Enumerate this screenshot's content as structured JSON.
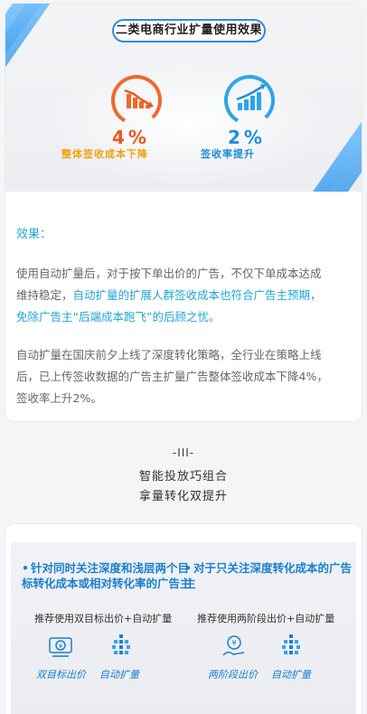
{
  "banner": {
    "title": "二类电商行业扩量使用效果",
    "metrics": [
      {
        "value": "4%",
        "label": "整体签收成本下降",
        "color": "#e9571d"
      },
      {
        "value": "2%",
        "label": "签收率提升",
        "color": "#1f8de0"
      }
    ]
  },
  "effect": {
    "title": "效果：",
    "para1_line1": "使用自动扩量后，对于按下单出价的广告，不仅下单成本达成",
    "para1_line2a": "维持稳定，",
    "para1_line2b": "自动扩量的扩展人群签收成本也符合广告主预期，",
    "para1_line3": "免除广告主“后端成本跑飞”的后顾之忧。",
    "para2_line1": "自动扩量在国庆前夕上线了深度转化策略，全行业在策略上线",
    "para2_line2": "后，已上传签收数据的广告主扩量广告整体签收成本下降4%，",
    "para2_line3": "签收率上升2%。"
  },
  "section": {
    "number": "-III-",
    "line1": "智能投放巧组合",
    "line2": "拿量转化双提升"
  },
  "cases": [
    {
      "bullet": "•",
      "title": "针对同时关注深度和浅层两个目标转化成本或相对转化率的广告主",
      "recommend": "推荐使用双目标出价+自动扩量",
      "tools": [
        {
          "icon": "yuan-dual-target-icon",
          "label": "双目标出价"
        },
        {
          "icon": "auto-expand-icon",
          "label": "自动扩量"
        }
      ]
    },
    {
      "bullet": "•",
      "title": "对于只关注深度转化成本的广告主",
      "recommend": "推荐使用两阶段出价+自动扩量",
      "tools": [
        {
          "icon": "yuan-two-stage-icon",
          "label": "两阶段出价"
        },
        {
          "icon": "auto-expand-icon",
          "label": "自动扩量"
        }
      ]
    }
  ],
  "colors": {
    "accent_blue": "#1fa6d8",
    "title_blue": "#1a7fd0",
    "orange": "#f2a00e",
    "red": "#e9571d"
  }
}
